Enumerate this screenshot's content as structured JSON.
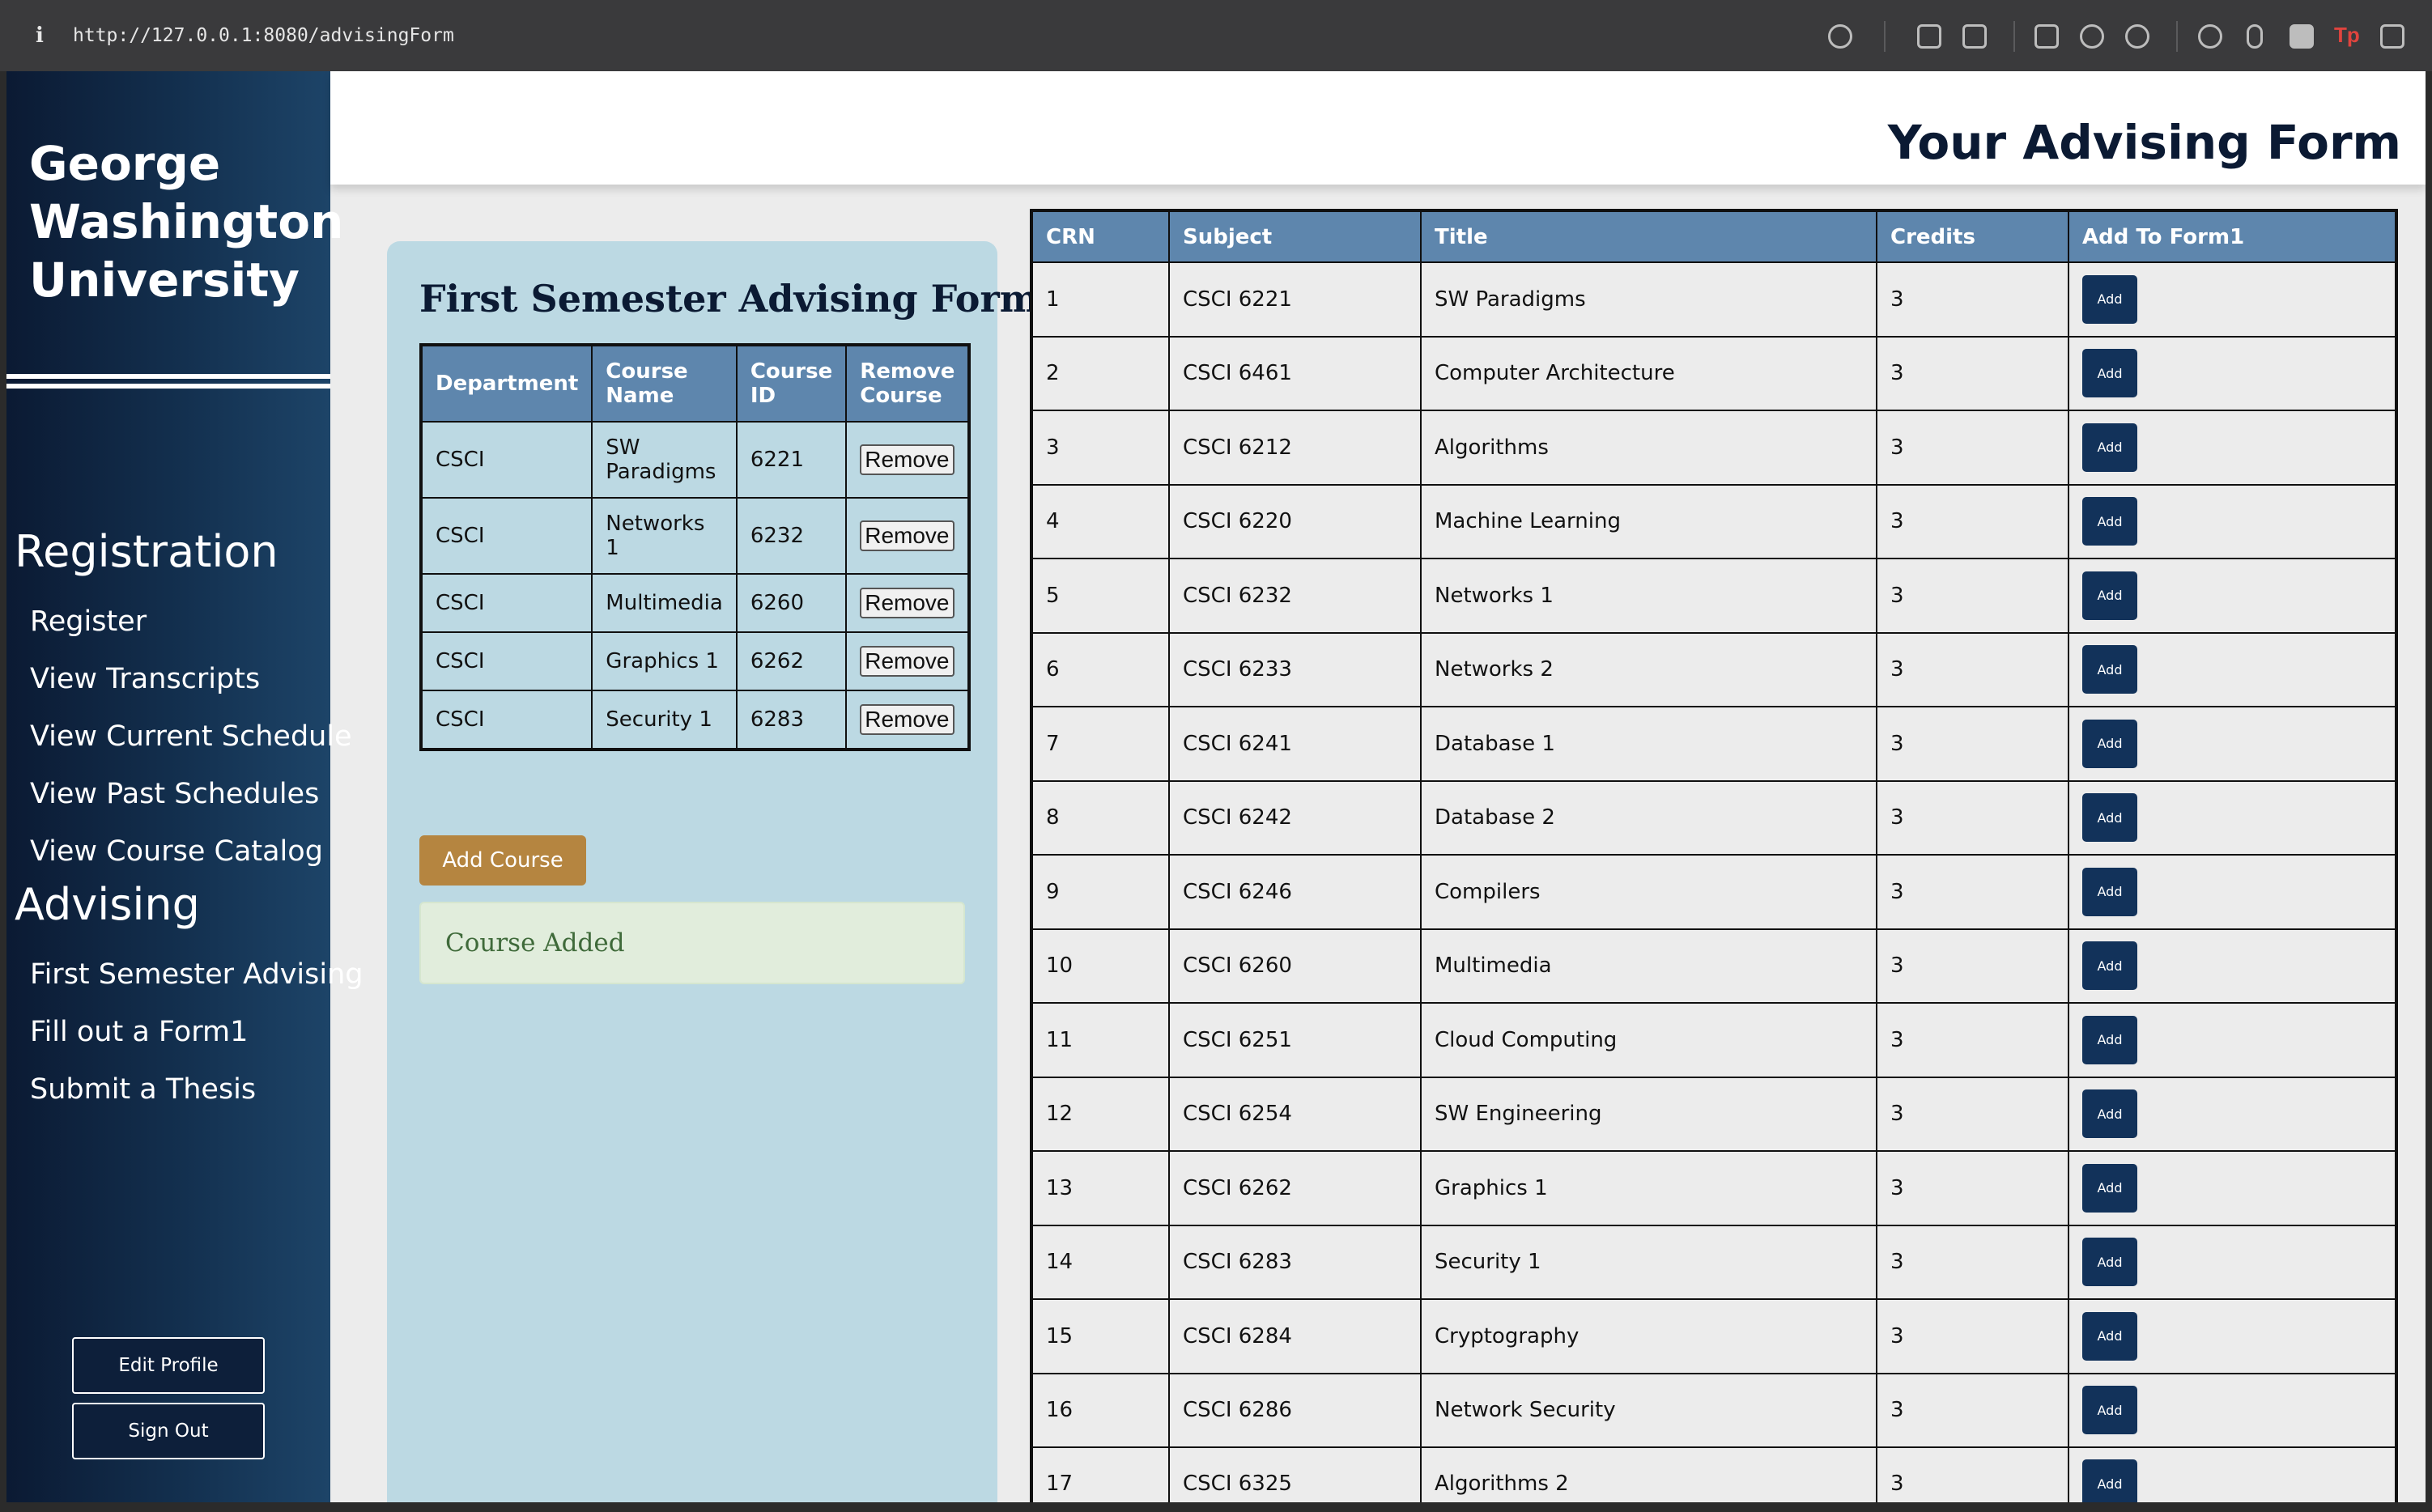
{
  "browser": {
    "url": "http://127.0.0.1:8080/advisingForm",
    "info_glyph": "i",
    "tp_glyph": "Tp"
  },
  "sidebar": {
    "university": "George Washington University",
    "sections": [
      {
        "heading": "Registration",
        "items": [
          "Register",
          "View Transcripts",
          "View Current Schedule",
          "View Past Schedules",
          "View Course Catalog"
        ]
      },
      {
        "heading": "Advising",
        "items": [
          "First Semester Advising",
          "Fill out a Form1",
          "Submit a Thesis"
        ]
      }
    ],
    "edit_profile": "Edit Profile",
    "sign_out": "Sign Out"
  },
  "header": {
    "title": "Your Advising Form"
  },
  "advising_form": {
    "title": "First Semester Advising Form",
    "columns": [
      "Department",
      "Course Name",
      "Course ID",
      "Remove Course"
    ],
    "rows": [
      {
        "department": "CSCI",
        "course_name": "SW Paradigms",
        "course_id": "6221",
        "action": "Remove"
      },
      {
        "department": "CSCI",
        "course_name": "Networks 1",
        "course_id": "6232",
        "action": "Remove"
      },
      {
        "department": "CSCI",
        "course_name": "Multimedia",
        "course_id": "6260",
        "action": "Remove"
      },
      {
        "department": "CSCI",
        "course_name": "Graphics 1",
        "course_id": "6262",
        "action": "Remove"
      },
      {
        "department": "CSCI",
        "course_name": "Security 1",
        "course_id": "6283",
        "action": "Remove"
      }
    ],
    "add_course_label": "Add Course",
    "alert": "Course Added"
  },
  "catalog": {
    "columns": [
      "CRN",
      "Subject",
      "Title",
      "Credits",
      "Add To Form1"
    ],
    "rows": [
      {
        "crn": "1",
        "subject": "CSCI 6221",
        "title": "SW Paradigms",
        "credits": "3",
        "action": "Add"
      },
      {
        "crn": "2",
        "subject": "CSCI 6461",
        "title": "Computer Architecture",
        "credits": "3",
        "action": "Add"
      },
      {
        "crn": "3",
        "subject": "CSCI 6212",
        "title": "Algorithms",
        "credits": "3",
        "action": "Add"
      },
      {
        "crn": "4",
        "subject": "CSCI 6220",
        "title": "Machine Learning",
        "credits": "3",
        "action": "Add"
      },
      {
        "crn": "5",
        "subject": "CSCI 6232",
        "title": "Networks 1",
        "credits": "3",
        "action": "Add"
      },
      {
        "crn": "6",
        "subject": "CSCI 6233",
        "title": "Networks 2",
        "credits": "3",
        "action": "Add"
      },
      {
        "crn": "7",
        "subject": "CSCI 6241",
        "title": "Database 1",
        "credits": "3",
        "action": "Add"
      },
      {
        "crn": "8",
        "subject": "CSCI 6242",
        "title": "Database 2",
        "credits": "3",
        "action": "Add"
      },
      {
        "crn": "9",
        "subject": "CSCI 6246",
        "title": "Compilers",
        "credits": "3",
        "action": "Add"
      },
      {
        "crn": "10",
        "subject": "CSCI 6260",
        "title": "Multimedia",
        "credits": "3",
        "action": "Add"
      },
      {
        "crn": "11",
        "subject": "CSCI 6251",
        "title": "Cloud Computing",
        "credits": "3",
        "action": "Add"
      },
      {
        "crn": "12",
        "subject": "CSCI 6254",
        "title": "SW Engineering",
        "credits": "3",
        "action": "Add"
      },
      {
        "crn": "13",
        "subject": "CSCI 6262",
        "title": "Graphics 1",
        "credits": "3",
        "action": "Add"
      },
      {
        "crn": "14",
        "subject": "CSCI 6283",
        "title": "Security 1",
        "credits": "3",
        "action": "Add"
      },
      {
        "crn": "15",
        "subject": "CSCI 6284",
        "title": "Cryptography",
        "credits": "3",
        "action": "Add"
      },
      {
        "crn": "16",
        "subject": "CSCI 6286",
        "title": "Network Security",
        "credits": "3",
        "action": "Add"
      },
      {
        "crn": "17",
        "subject": "CSCI 6325",
        "title": "Algorithms 2",
        "credits": "3",
        "action": "Add"
      }
    ]
  },
  "colors": {
    "sidebar_dark": "#0b1a33",
    "table_header": "#5e86ad",
    "card_bg": "#bcd9e3",
    "add_course": "#b58540",
    "add_button": "#12325a",
    "alert_bg": "#e1eddc"
  },
  "icons": [
    "info-icon",
    "link-icon",
    "download-icon",
    "camera-icon",
    "terminal-icon",
    "globe-icon",
    "crosshair-icon",
    "extensions-icon",
    "pen-icon",
    "script-icon",
    "sidebar-toggle-icon"
  ]
}
